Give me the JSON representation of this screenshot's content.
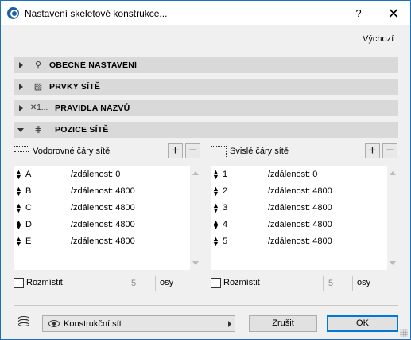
{
  "window": {
    "title": "Nastavení skeletové konstrukce..."
  },
  "titlebar": {
    "help_glyph": "?",
    "close_glyph": "✕"
  },
  "defaults_label": "Výchozí",
  "sections": [
    {
      "label": "OBECNÉ NASTAVENÍ",
      "icon": "pin-icon",
      "expanded": false
    },
    {
      "label": "PRVKY SÍTĚ",
      "icon": "grid-element-icon",
      "expanded": false
    },
    {
      "label": "PRAVIDLA NÁZVŮ",
      "icon": "naming-icon",
      "icon_text": "✕1...",
      "expanded": false
    },
    {
      "label": "POZICE SÍTĚ",
      "icon": "grid-position-icon",
      "expanded": true
    }
  ],
  "horizontal": {
    "title": "Vodorovné čáry sítě",
    "add": "+",
    "remove": "−",
    "rows": [
      {
        "name": "A",
        "distance": "/zdálenost: 0"
      },
      {
        "name": "B",
        "distance": "/zdálenost: 4800"
      },
      {
        "name": "C",
        "distance": "/zdálenost: 4800"
      },
      {
        "name": "D",
        "distance": "/zdálenost: 4800"
      },
      {
        "name": "E",
        "distance": "/zdálenost: 4800"
      }
    ],
    "distribute_label": "Rozmístit",
    "count": "5",
    "count_unit": "osy"
  },
  "vertical": {
    "title": "Svislé čáry sítě",
    "add": "+",
    "remove": "−",
    "rows": [
      {
        "name": "1",
        "distance": "/zdálenost: 0"
      },
      {
        "name": "2",
        "distance": "/zdálenost: 4800"
      },
      {
        "name": "3",
        "distance": "/zdálenost: 4800"
      },
      {
        "name": "4",
        "distance": "/zdálenost: 4800"
      },
      {
        "name": "5",
        "distance": "/zdálenost: 4800"
      }
    ],
    "distribute_label": "Rozmístit",
    "count": "5",
    "count_unit": "osy"
  },
  "footer": {
    "layer": "Konstrukční síť",
    "cancel": "Zrušit",
    "ok": "OK"
  },
  "colors": {
    "accent": "#0078d7",
    "section_bg": "#d9d9d9"
  }
}
